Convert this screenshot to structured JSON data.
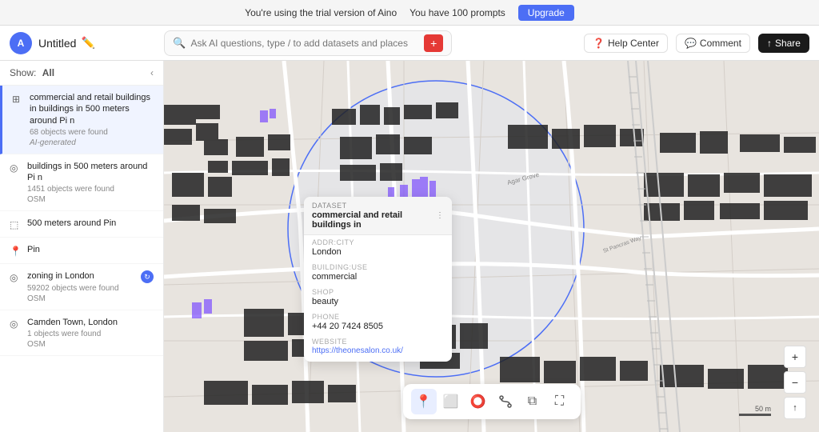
{
  "banner": {
    "trial_text": "You're using the trial version of Aino",
    "prompts_text": "You have 100 prompts",
    "upgrade_label": "Upgrade"
  },
  "header": {
    "logo_text": "A",
    "title": "Untitled",
    "search_placeholder": "Ask AI questions, type / to add datasets and places",
    "help_label": "Help Center",
    "comment_label": "Comment",
    "share_label": "Share"
  },
  "sidebar": {
    "show_label": "Show:",
    "show_value": "All",
    "layers": [
      {
        "id": "commercial",
        "icon": "grid",
        "title": "commercial and retail buildings in buildings in 500 meters around Pi n",
        "subtitle1": "68 objects were found",
        "subtitle2": "AI-generated",
        "active": true
      },
      {
        "id": "buildings",
        "icon": "dot",
        "title": "buildings in 500 meters around Pi n",
        "subtitle1": "1451 objects were found",
        "subtitle2": "OSM",
        "active": false
      },
      {
        "id": "radius",
        "icon": "square",
        "title": "500 meters around Pin",
        "subtitle1": "",
        "subtitle2": "",
        "active": false
      },
      {
        "id": "pin",
        "icon": "pin",
        "title": "Pin",
        "subtitle1": "",
        "subtitle2": "",
        "active": false
      },
      {
        "id": "zoning",
        "icon": "dot",
        "title": "zoning in London",
        "subtitle1": "59202 objects were found",
        "subtitle2": "OSM",
        "active": false,
        "badge": true
      },
      {
        "id": "camden",
        "icon": "dot",
        "title": "Camden Town, London",
        "subtitle1": "1 objects were found",
        "subtitle2": "OSM",
        "active": false
      }
    ]
  },
  "popup": {
    "dataset_label": "DATASET",
    "dataset_title": "commercial and retail buildings in",
    "fields": [
      {
        "label": "ADDR:CITY",
        "value": "London"
      },
      {
        "label": "BUILDING:USE",
        "value": "commercial"
      },
      {
        "label": "SHOP",
        "value": "beauty"
      },
      {
        "label": "PHONE",
        "value": "+44 20 7424 8505"
      },
      {
        "label": "WEBSITE",
        "value": "https://theonesalon.co.uk/"
      }
    ]
  },
  "toolbar": {
    "tools": [
      {
        "id": "pin",
        "icon": "📍"
      },
      {
        "id": "rectangle",
        "icon": "⬜"
      },
      {
        "id": "circle",
        "icon": "⭕"
      },
      {
        "id": "route",
        "icon": "🔀"
      },
      {
        "id": "layer",
        "icon": "⧉"
      },
      {
        "id": "expand",
        "icon": "⛶"
      }
    ]
  },
  "map_controls": {
    "zoom_in": "+",
    "zoom_out": "−",
    "compass": "↑",
    "scale_label": "50 m"
  }
}
